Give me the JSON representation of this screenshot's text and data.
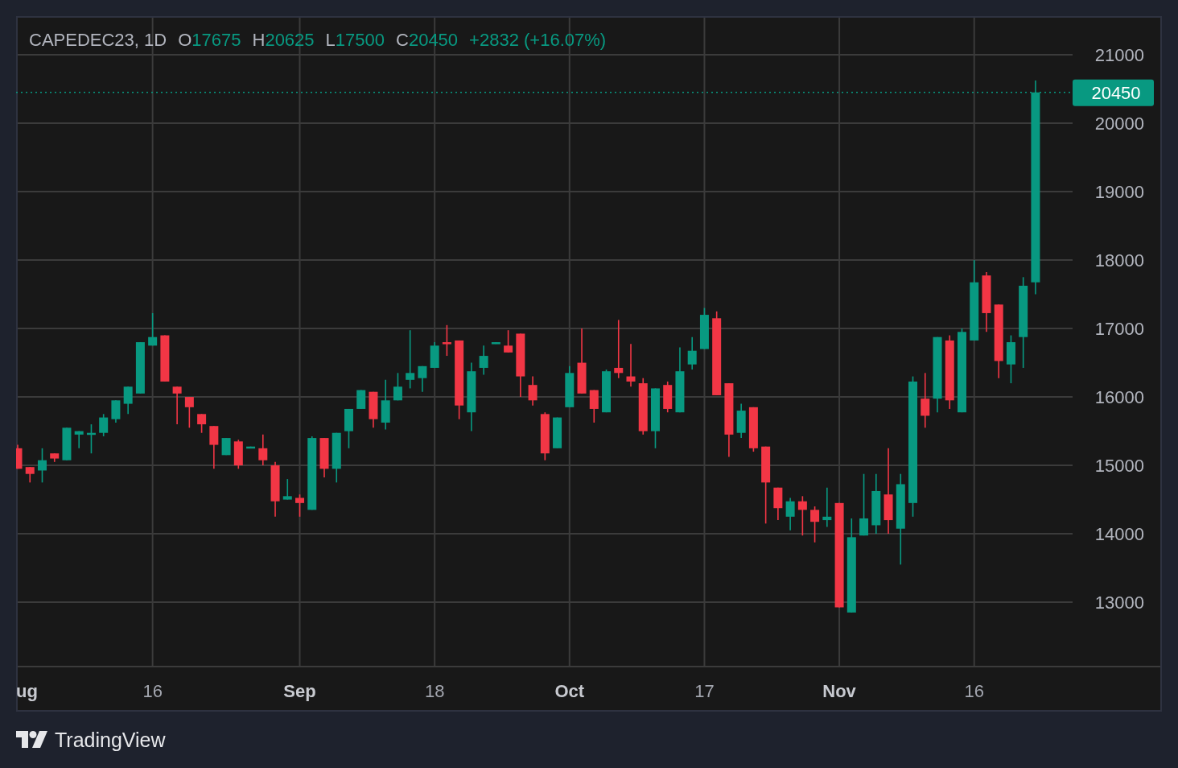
{
  "chart": {
    "symbol": "CAPEDEC23, 1D",
    "ohlc": [
      {
        "label": "O",
        "value": "17675"
      },
      {
        "label": "H",
        "value": "20625"
      },
      {
        "label": "L",
        "value": "17500"
      },
      {
        "label": "C",
        "value": "20450"
      }
    ],
    "change": "+2832 (+16.07%)",
    "chart_data": {
      "type": "candlestick",
      "grid": true,
      "ylim": [
        12060,
        21565
      ],
      "categories": [
        "ug",
        null,
        null,
        null,
        null,
        null,
        null,
        null,
        null,
        null,
        null,
        "16",
        null,
        null,
        null,
        null,
        null,
        null,
        null,
        null,
        null,
        null,
        null,
        "Sep",
        null,
        null,
        null,
        null,
        null,
        null,
        null,
        null,
        null,
        null,
        "18",
        null,
        null,
        null,
        null,
        null,
        null,
        null,
        null,
        null,
        null,
        "Oct",
        null,
        null,
        null,
        null,
        null,
        null,
        null,
        null,
        null,
        null,
        "17",
        null,
        null,
        null,
        null,
        null,
        null,
        null,
        null,
        null,
        null,
        "Nov",
        null,
        null,
        null,
        null,
        null,
        null,
        null,
        null,
        null,
        null,
        "16",
        null,
        null,
        null,
        null,
        null
      ],
      "ref_lines": [
        {
          "axis": "y",
          "value": 20450,
          "label": "20450"
        }
      ],
      "yticks": [
        13000,
        14000,
        15000,
        16000,
        17000,
        18000,
        19000,
        20000,
        21000
      ],
      "series": [
        {
          "ohlc": [
            [
              15250,
              15300,
              14950,
              14950
            ],
            [
              14975,
              14975,
              14750,
              14875
            ],
            [
              14925,
              15250,
              14750,
              15075
            ],
            [
              15175,
              15175,
              15050,
              15100
            ],
            [
              15075,
              15550,
              15075,
              15550
            ],
            [
              15450,
              15500,
              15250,
              15500
            ],
            [
              15450,
              15600,
              15175,
              15475
            ],
            [
              15475,
              15750,
              15425,
              15700
            ],
            [
              15675,
              15950,
              15625,
              15950
            ],
            [
              15900,
              16150,
              15750,
              16150
            ],
            [
              16050,
              16800,
              16050,
              16800
            ],
            [
              16750,
              17225,
              16750,
              16875
            ],
            [
              16900,
              16900,
              16225,
              16225
            ],
            [
              16150,
              16150,
              15600,
              16050
            ],
            [
              16000,
              16000,
              15550,
              15850
            ],
            [
              15750,
              15750,
              15475,
              15600
            ],
            [
              15575,
              15575,
              14950,
              15300
            ],
            [
              15150,
              15400,
              15150,
              15400
            ],
            [
              15350,
              15375,
              14950,
              15000
            ],
            [
              15250,
              15275,
              15250,
              15275
            ],
            [
              15250,
              15450,
              15000,
              15075
            ],
            [
              15000,
              15050,
              14250,
              14475
            ],
            [
              14500,
              14800,
              14500,
              14550
            ],
            [
              14525,
              14575,
              14250,
              14450
            ],
            [
              14350,
              15425,
              14350,
              15400
            ],
            [
              15400,
              15400,
              14825,
              14950
            ],
            [
              14950,
              15475,
              14750,
              15475
            ],
            [
              15500,
              15825,
              15250,
              15825
            ],
            [
              15825,
              16100,
              15825,
              16100
            ],
            [
              16075,
              16075,
              15550,
              15675
            ],
            [
              15625,
              16250,
              15525,
              15950
            ],
            [
              15950,
              16350,
              15950,
              16150
            ],
            [
              16250,
              16975,
              16125,
              16350
            ],
            [
              16275,
              16450,
              16075,
              16450
            ],
            [
              16425,
              16800,
              16425,
              16750
            ],
            [
              16800,
              17050,
              16600,
              16775
            ],
            [
              16825,
              16825,
              15675,
              15875
            ],
            [
              15775,
              16500,
              15500,
              16375
            ],
            [
              16425,
              16750,
              16325,
              16600
            ],
            [
              16775,
              16800,
              16775,
              16800
            ],
            [
              16750,
              16975,
              16650,
              16650
            ],
            [
              16925,
              16925,
              16000,
              16300
            ],
            [
              16175,
              16300,
              15875,
              15950
            ],
            [
              15750,
              15775,
              15075,
              15175
            ],
            [
              15250,
              15700,
              15250,
              15700
            ],
            [
              15850,
              16450,
              15850,
              16350
            ],
            [
              16500,
              17000,
              16050,
              16050
            ],
            [
              16100,
              16100,
              15625,
              15825
            ],
            [
              15775,
              16400,
              15775,
              16375
            ],
            [
              16425,
              17125,
              16275,
              16350
            ],
            [
              16300,
              16775,
              16150,
              16225
            ],
            [
              16200,
              16275,
              15450,
              15500
            ],
            [
              15500,
              16125,
              15250,
              16125
            ],
            [
              16175,
              16225,
              15775,
              15825
            ],
            [
              15775,
              16725,
              15775,
              16375
            ],
            [
              16475,
              16875,
              16400,
              16675
            ],
            [
              16700,
              17300,
              16700,
              17200
            ],
            [
              17150,
              17250,
              16025,
              16025
            ],
            [
              16200,
              16200,
              15125,
              15450
            ],
            [
              15475,
              15900,
              15400,
              15800
            ],
            [
              15850,
              15850,
              15200,
              15250
            ],
            [
              15275,
              15275,
              14150,
              14750
            ],
            [
              14675,
              14675,
              14200,
              14375
            ],
            [
              14250,
              14525,
              14050,
              14475
            ],
            [
              14475,
              14550,
              13975,
              14350
            ],
            [
              14350,
              14400,
              13875,
              14175
            ],
            [
              14200,
              14675,
              14100,
              14250
            ],
            [
              14450,
              14450,
              12925,
              12925
            ],
            [
              12850,
              14225,
              12850,
              13950
            ],
            [
              13975,
              14875,
              13975,
              14225
            ],
            [
              14125,
              14875,
              14000,
              14625
            ],
            [
              14575,
              15250,
              14000,
              14200
            ],
            [
              14075,
              14875,
              13550,
              14725
            ],
            [
              14450,
              16300,
              14250,
              16225
            ],
            [
              15975,
              16350,
              15550,
              15725
            ],
            [
              15975,
              16875,
              15775,
              16875
            ],
            [
              16825,
              16900,
              15825,
              15950
            ],
            [
              15775,
              17000,
              15775,
              16950
            ],
            [
              16825,
              18000,
              16825,
              17675
            ],
            [
              17775,
              17825,
              16950,
              17225
            ],
            [
              17350,
              17350,
              16275,
              16525
            ],
            [
              16475,
              16900,
              16200,
              16800
            ],
            [
              16875,
              17750,
              16425,
              17625
            ],
            [
              17675,
              20625,
              17500,
              20450
            ]
          ]
        }
      ]
    }
  },
  "footer": {
    "brand": "TradingView"
  }
}
